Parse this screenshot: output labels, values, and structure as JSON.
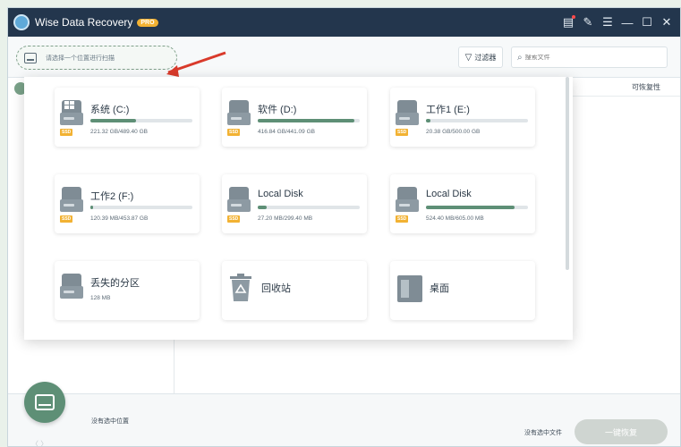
{
  "app": {
    "title": "Wise Data Recovery",
    "badge": "PRO"
  },
  "window_controls": [
    {
      "name": "feedback-icon",
      "glyph": "▤"
    },
    {
      "name": "edit-icon",
      "glyph": "✎"
    },
    {
      "name": "menu-icon",
      "glyph": "☰"
    },
    {
      "name": "minimize-icon",
      "glyph": "—"
    },
    {
      "name": "maximize-icon",
      "glyph": "☐"
    },
    {
      "name": "close-icon",
      "glyph": "✕"
    }
  ],
  "toolbar": {
    "location_placeholder": "请选择一个位置进行扫描",
    "filter_label": "过滤器",
    "search_placeholder": "搜索文件"
  },
  "content": {
    "preview_label": "可恢复性"
  },
  "bottom": {
    "no_location": "没有选中位置",
    "no_file": "没有选中文件",
    "recover_button": "一键恢复",
    "pager": "〈 〉"
  },
  "drives": [
    {
      "name": "系统 (C:)",
      "size": "221.32 GB/489.40 GB",
      "used": 0.45,
      "ssd": true,
      "system": true,
      "icon": "hdd-icon"
    },
    {
      "name": "软件 (D:)",
      "size": "416.84 GB/441.09 GB",
      "used": 0.95,
      "ssd": true,
      "system": false,
      "icon": "hdd-icon"
    },
    {
      "name": "工作1 (E:)",
      "size": "20.38 GB/500.00 GB",
      "used": 0.04,
      "ssd": true,
      "system": false,
      "icon": "hdd-icon"
    },
    {
      "name": "工作2 (F:)",
      "size": "120.39 MB/453.87 GB",
      "used": 0.02,
      "ssd": true,
      "system": false,
      "icon": "hdd-icon"
    },
    {
      "name": "Local Disk",
      "size": "27.20 MB/299.40 MB",
      "used": 0.09,
      "ssd": true,
      "system": false,
      "icon": "hdd-icon"
    },
    {
      "name": "Local Disk",
      "size": "524.40 MB/605.00 MB",
      "used": 0.87,
      "ssd": true,
      "system": false,
      "icon": "hdd-icon"
    },
    {
      "name": "丢失的分区",
      "size": "128 MB",
      "used": null,
      "ssd": false,
      "system": false,
      "icon": "hdd-icon"
    },
    {
      "name": "回收站",
      "size": "",
      "used": null,
      "ssd": false,
      "system": false,
      "icon": "recycle-bin-icon"
    },
    {
      "name": "桌面",
      "size": "",
      "used": null,
      "ssd": false,
      "system": false,
      "icon": "desktop-icon"
    }
  ],
  "colors": {
    "titlebar": "#23364d",
    "accent": "#5e8f76",
    "badge": "#f2b233",
    "arrow": "#d93a2b"
  }
}
